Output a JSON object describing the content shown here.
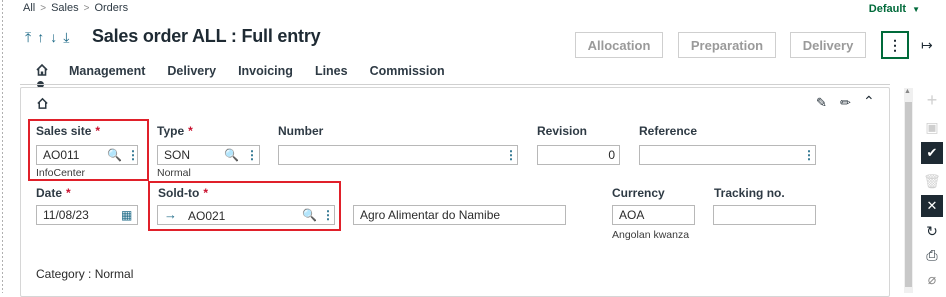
{
  "breadcrumb": {
    "items": [
      "All",
      "Sales",
      "Orders"
    ],
    "sep": ">"
  },
  "default_link": {
    "label": "Default"
  },
  "header": {
    "title": "Sales order ALL : Full entry",
    "buttons": {
      "allocation": "Allocation",
      "preparation": "Preparation",
      "delivery": "Delivery"
    }
  },
  "tabs": [
    "Management",
    "Delivery",
    "Invoicing",
    "Lines",
    "Commission"
  ],
  "form": {
    "sales_site": {
      "label": "Sales site",
      "value": "AO011",
      "sub": "InfoCenter"
    },
    "type": {
      "label": "Type",
      "value": "SON",
      "sub": "Normal"
    },
    "number": {
      "label": "Number",
      "value": ""
    },
    "revision": {
      "label": "Revision",
      "value": "0"
    },
    "reference": {
      "label": "Reference",
      "value": ""
    },
    "date": {
      "label": "Date",
      "value": "11/08/23"
    },
    "sold_to": {
      "label": "Sold-to",
      "value": "AO021",
      "name": "Agro Alimentar do Namibe"
    },
    "currency": {
      "label": "Currency",
      "value": "AOA",
      "sub": "Angolan kwanza"
    },
    "tracking": {
      "label": "Tracking no.",
      "value": ""
    },
    "category_text": "Category : Normal"
  },
  "colors": {
    "accent": "#006a3a",
    "highlight": "#e0202a",
    "icon": "#1d6a87"
  }
}
